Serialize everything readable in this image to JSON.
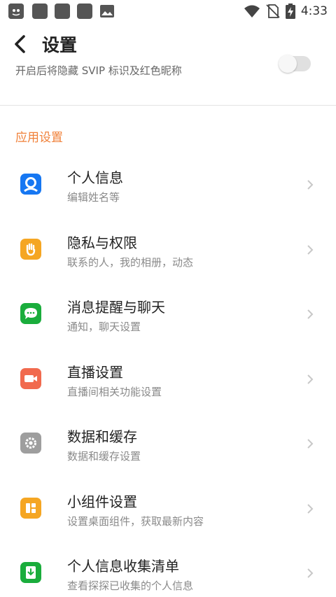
{
  "status_bar": {
    "time": "4:33",
    "icons": [
      "app-notification-icon",
      "square-notification-icon",
      "square-notification-icon",
      "square-notification-icon",
      "image-notification-icon",
      "wifi-icon",
      "no-sim-icon",
      "battery-charging-icon"
    ]
  },
  "header": {
    "title": "设置"
  },
  "partial_setting": {
    "text": "开启后将隐藏 SVIP 标识及红色昵称",
    "enabled": false
  },
  "section": {
    "title": "应用设置"
  },
  "colors": {
    "accent": "#f0813a",
    "personal": "#1677f2",
    "privacy": "#f5a623",
    "message": "#1aad3c",
    "live": "#f16a4e",
    "data": "#9e9e9e",
    "widget": "#f5a623",
    "collect": "#1aad3c"
  },
  "items": [
    {
      "title": "个人信息",
      "subtitle": "编辑姓名等",
      "icon": "user-icon"
    },
    {
      "title": "隐私与权限",
      "subtitle": "联系的人，我的相册，动态",
      "icon": "hand-icon"
    },
    {
      "title": "消息提醒与聊天",
      "subtitle": "通知，聊天设置",
      "icon": "chat-icon"
    },
    {
      "title": "直播设置",
      "subtitle": "直播间相关功能设置",
      "icon": "video-camera-icon"
    },
    {
      "title": "数据和缓存",
      "subtitle": "数据和缓存设置",
      "icon": "gear-icon"
    },
    {
      "title": "小组件设置",
      "subtitle": "设置桌面组件，获取最新内容",
      "icon": "widget-icon"
    },
    {
      "title": "个人信息收集清单",
      "subtitle": "查看探探已收集的个人信息",
      "icon": "download-list-icon"
    }
  ]
}
